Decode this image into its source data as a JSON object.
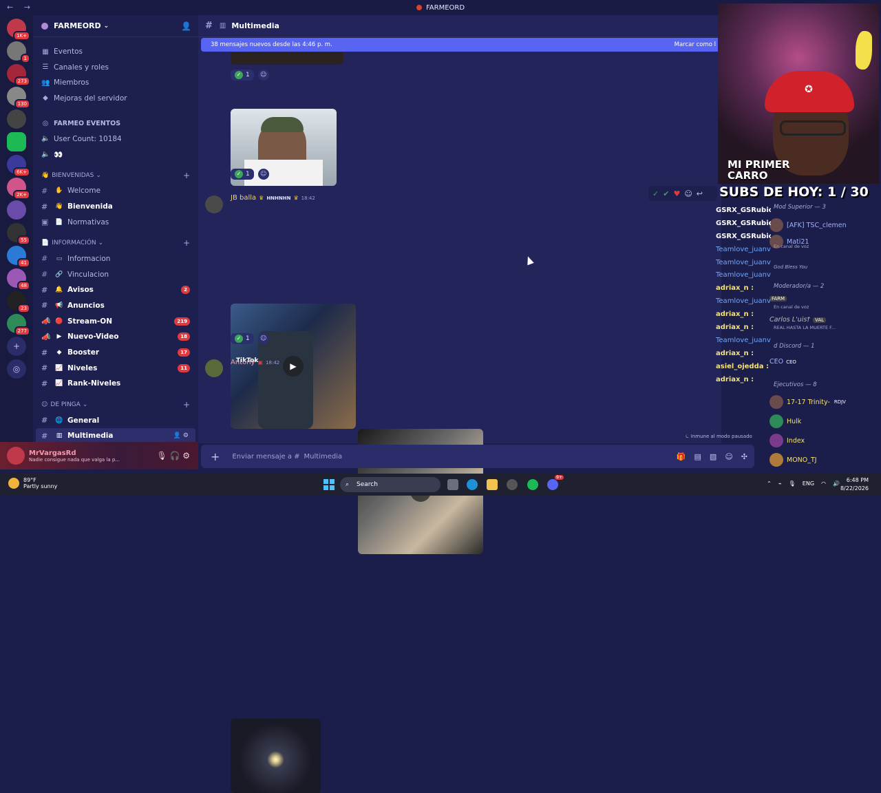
{
  "app": {
    "title": "FARMEORD",
    "back": "←",
    "forward": "→"
  },
  "guild_badges": [
    "1K+",
    "1",
    "273",
    "130",
    "",
    "",
    "6K+",
    "2K+",
    "",
    "55",
    "41",
    "48",
    "23",
    "277"
  ],
  "server": {
    "name": "FARMEORD",
    "menu": [
      "Eventos",
      "Canales y roles",
      "Miembros",
      "Mejoras del servidor"
    ],
    "header_section": "FARMEO EVENTOS",
    "user_count": "User Count: 10184",
    "voice_emoji": "👀",
    "categories": {
      "bienvenidas": "BIENVENIDAS",
      "informacion": "INFORMACIÓN",
      "de_pinga": "DE PINGA"
    },
    "channels": {
      "welcome": "Welcome",
      "bienvenida": "Bienvenida",
      "normativas": "Normativas",
      "informacion": "Informacion",
      "vinculacion": "Vinculacion",
      "avisos": "Avisos",
      "anuncios": "Anuncios",
      "stream_on": "Stream-ON",
      "nuevo_video": "Nuevo-Video",
      "booster": "Booster",
      "niveles": "Niveles",
      "rank_niveles": "Rank-Niveles",
      "general": "General",
      "multimedia": "Multimedia"
    },
    "counts": {
      "avisos": "2",
      "stream_on": "219",
      "nuevo_video": "18",
      "booster": "17",
      "niveles": "11"
    }
  },
  "user": {
    "name": "MrVargasRd",
    "status": "Nadie consigue nada que valga la p..."
  },
  "chat": {
    "channel": "Multimedia",
    "new_messages": "38 mensajes nuevos desde las 4:46 p. m.",
    "mark_read": "Marcar como l",
    "reaction_count": "1",
    "msg2_author": "JB balla",
    "msg2_tag": "HNHNHN",
    "msg2_time": "18:42",
    "tiktok": "TikTok",
    "msg3_author": "Antony",
    "msg3_time": "18:42",
    "composer_placeholder": "Enviar mensaje a #",
    "composer_channel": "Multimedia",
    "idle_notice": "Inmune al modo pausado"
  },
  "stream": {
    "overlay_title": "MI PRIMER CARRO",
    "subs": "SUBS DE HOY: 1 / 30",
    "chat_lines": [
      {
        "name": "GSRX_GSRubio :",
        "style": "white"
      },
      {
        "name": "GSRX_GSRubio :",
        "style": "white"
      },
      {
        "name": "GSRX_GSRubio :",
        "style": "white"
      },
      {
        "name": "Teamlove_juanvos :",
        "style": "blue"
      },
      {
        "name": "Teamlove_juanvos :",
        "style": "blue"
      },
      {
        "name": "Teamlove_juanvos :",
        "style": "blue"
      },
      {
        "name": "adriax_n :",
        "style": "yel"
      },
      {
        "name": "Teamlove_juanvos :",
        "style": "blue"
      },
      {
        "name": "adriax_n :",
        "style": "yel"
      },
      {
        "name": "adriax_n :",
        "style": "yel"
      },
      {
        "name": "Teamlove_juanvos :",
        "style": "blue"
      },
      {
        "name": "adriax_n :",
        "style": "yel"
      },
      {
        "name": "asiel_ojedda :",
        "style": "yel"
      },
      {
        "name": "adriax_n :",
        "style": "yel"
      }
    ]
  },
  "members": {
    "mod_superior": "Mod Superior — 3",
    "m1": "[AFK] TSC_clemen",
    "m2": "Mati21",
    "m2_status": "En canal de voz",
    "m3_status": "God Bless You",
    "moderador": "Moderador/a — 2",
    "m4_status": "En canal de voz",
    "m4_tag": "FARM",
    "m5": "Carlos L'uis†",
    "m5_tag": "VAL",
    "m5_status": "REAL HASTA LA MUERTE F...",
    "discord_grp": "d Discord — 1",
    "m6": "CEO",
    "m6_tag": "CEO",
    "ejecutivos": "Ejecutivos — 8",
    "m7": "17-17 Trinity-",
    "m7_tag": "RDJV",
    "m8": "Hulk",
    "m9": "Index",
    "m10": "MONO_TJ"
  },
  "taskbar": {
    "temp": "89°F",
    "condition": "Partly sunny",
    "search": "Search",
    "lang": "ENG",
    "time": "6:48 PM",
    "date": "8/22/2026",
    "discord_badge": "9+"
  }
}
